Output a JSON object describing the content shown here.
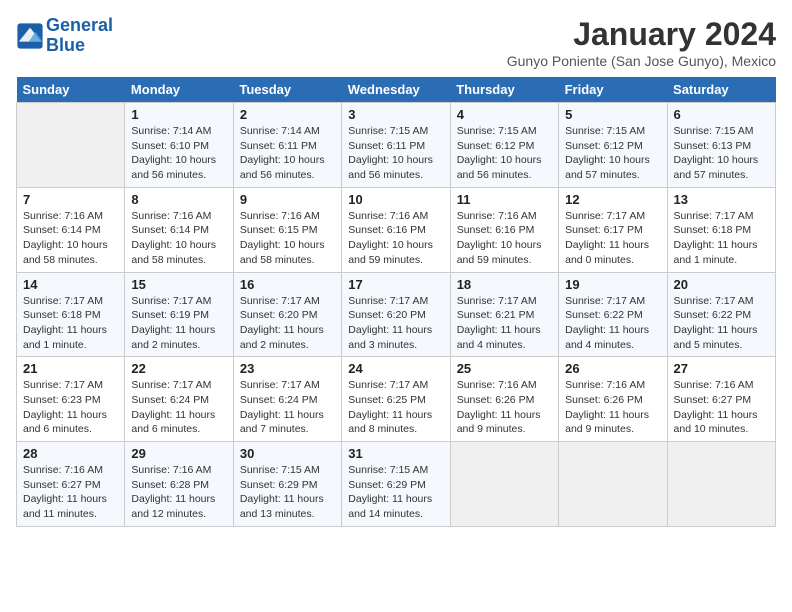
{
  "header": {
    "logo_line1": "General",
    "logo_line2": "Blue",
    "month": "January 2024",
    "location": "Gunyo Poniente (San Jose Gunyo), Mexico"
  },
  "weekdays": [
    "Sunday",
    "Monday",
    "Tuesday",
    "Wednesday",
    "Thursday",
    "Friday",
    "Saturday"
  ],
  "weeks": [
    [
      {
        "day": "",
        "info": ""
      },
      {
        "day": "1",
        "info": "Sunrise: 7:14 AM\nSunset: 6:10 PM\nDaylight: 10 hours\nand 56 minutes."
      },
      {
        "day": "2",
        "info": "Sunrise: 7:14 AM\nSunset: 6:11 PM\nDaylight: 10 hours\nand 56 minutes."
      },
      {
        "day": "3",
        "info": "Sunrise: 7:15 AM\nSunset: 6:11 PM\nDaylight: 10 hours\nand 56 minutes."
      },
      {
        "day": "4",
        "info": "Sunrise: 7:15 AM\nSunset: 6:12 PM\nDaylight: 10 hours\nand 56 minutes."
      },
      {
        "day": "5",
        "info": "Sunrise: 7:15 AM\nSunset: 6:12 PM\nDaylight: 10 hours\nand 57 minutes."
      },
      {
        "day": "6",
        "info": "Sunrise: 7:15 AM\nSunset: 6:13 PM\nDaylight: 10 hours\nand 57 minutes."
      }
    ],
    [
      {
        "day": "7",
        "info": "Sunrise: 7:16 AM\nSunset: 6:14 PM\nDaylight: 10 hours\nand 58 minutes."
      },
      {
        "day": "8",
        "info": "Sunrise: 7:16 AM\nSunset: 6:14 PM\nDaylight: 10 hours\nand 58 minutes."
      },
      {
        "day": "9",
        "info": "Sunrise: 7:16 AM\nSunset: 6:15 PM\nDaylight: 10 hours\nand 58 minutes."
      },
      {
        "day": "10",
        "info": "Sunrise: 7:16 AM\nSunset: 6:16 PM\nDaylight: 10 hours\nand 59 minutes."
      },
      {
        "day": "11",
        "info": "Sunrise: 7:16 AM\nSunset: 6:16 PM\nDaylight: 10 hours\nand 59 minutes."
      },
      {
        "day": "12",
        "info": "Sunrise: 7:17 AM\nSunset: 6:17 PM\nDaylight: 11 hours\nand 0 minutes."
      },
      {
        "day": "13",
        "info": "Sunrise: 7:17 AM\nSunset: 6:18 PM\nDaylight: 11 hours\nand 1 minute."
      }
    ],
    [
      {
        "day": "14",
        "info": "Sunrise: 7:17 AM\nSunset: 6:18 PM\nDaylight: 11 hours\nand 1 minute."
      },
      {
        "day": "15",
        "info": "Sunrise: 7:17 AM\nSunset: 6:19 PM\nDaylight: 11 hours\nand 2 minutes."
      },
      {
        "day": "16",
        "info": "Sunrise: 7:17 AM\nSunset: 6:20 PM\nDaylight: 11 hours\nand 2 minutes."
      },
      {
        "day": "17",
        "info": "Sunrise: 7:17 AM\nSunset: 6:20 PM\nDaylight: 11 hours\nand 3 minutes."
      },
      {
        "day": "18",
        "info": "Sunrise: 7:17 AM\nSunset: 6:21 PM\nDaylight: 11 hours\nand 4 minutes."
      },
      {
        "day": "19",
        "info": "Sunrise: 7:17 AM\nSunset: 6:22 PM\nDaylight: 11 hours\nand 4 minutes."
      },
      {
        "day": "20",
        "info": "Sunrise: 7:17 AM\nSunset: 6:22 PM\nDaylight: 11 hours\nand 5 minutes."
      }
    ],
    [
      {
        "day": "21",
        "info": "Sunrise: 7:17 AM\nSunset: 6:23 PM\nDaylight: 11 hours\nand 6 minutes."
      },
      {
        "day": "22",
        "info": "Sunrise: 7:17 AM\nSunset: 6:24 PM\nDaylight: 11 hours\nand 6 minutes."
      },
      {
        "day": "23",
        "info": "Sunrise: 7:17 AM\nSunset: 6:24 PM\nDaylight: 11 hours\nand 7 minutes."
      },
      {
        "day": "24",
        "info": "Sunrise: 7:17 AM\nSunset: 6:25 PM\nDaylight: 11 hours\nand 8 minutes."
      },
      {
        "day": "25",
        "info": "Sunrise: 7:16 AM\nSunset: 6:26 PM\nDaylight: 11 hours\nand 9 minutes."
      },
      {
        "day": "26",
        "info": "Sunrise: 7:16 AM\nSunset: 6:26 PM\nDaylight: 11 hours\nand 9 minutes."
      },
      {
        "day": "27",
        "info": "Sunrise: 7:16 AM\nSunset: 6:27 PM\nDaylight: 11 hours\nand 10 minutes."
      }
    ],
    [
      {
        "day": "28",
        "info": "Sunrise: 7:16 AM\nSunset: 6:27 PM\nDaylight: 11 hours\nand 11 minutes."
      },
      {
        "day": "29",
        "info": "Sunrise: 7:16 AM\nSunset: 6:28 PM\nDaylight: 11 hours\nand 12 minutes."
      },
      {
        "day": "30",
        "info": "Sunrise: 7:15 AM\nSunset: 6:29 PM\nDaylight: 11 hours\nand 13 minutes."
      },
      {
        "day": "31",
        "info": "Sunrise: 7:15 AM\nSunset: 6:29 PM\nDaylight: 11 hours\nand 14 minutes."
      },
      {
        "day": "",
        "info": ""
      },
      {
        "day": "",
        "info": ""
      },
      {
        "day": "",
        "info": ""
      }
    ]
  ]
}
